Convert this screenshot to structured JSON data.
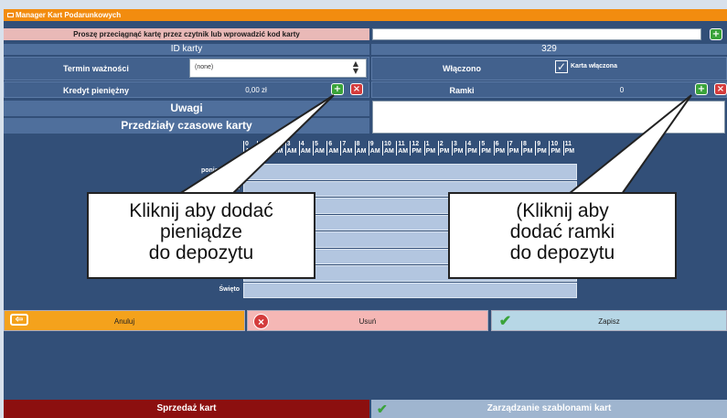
{
  "window": {
    "title": "Manager Kart Podarunkowych"
  },
  "swipe": {
    "prompt": "Proszę przeciągnąć kartę przez czytnik lub wprowadzić kod karty",
    "value": ""
  },
  "card": {
    "id_label": "ID karty",
    "id_value": "329",
    "expiry_label": "Termin ważności",
    "expiry_value": "(none)",
    "enabled_label": "Włączono",
    "enabled_checkbox_label": "Karta włączona",
    "credit_label": "Kredyt pieniężny",
    "credit_value": "0,00 zł",
    "frames_label": "Ramki",
    "frames_value": "0",
    "notes_label": "Uwagi",
    "timeslots_label": "Przedziały czasowe karty"
  },
  "schedule": {
    "hours": [
      "0",
      "1",
      "2",
      "3",
      "4",
      "5",
      "6",
      "7",
      "8",
      "9",
      "10",
      "11",
      "12",
      "1",
      "2",
      "3",
      "4",
      "5",
      "6",
      "7",
      "8",
      "9",
      "10",
      "11"
    ],
    "periods": [
      "AM",
      "AM",
      "AM",
      "AM",
      "AM",
      "AM",
      "AM",
      "AM",
      "AM",
      "AM",
      "AM",
      "AM",
      "PM",
      "PM",
      "PM",
      "PM",
      "PM",
      "PM",
      "PM",
      "PM",
      "PM",
      "PM",
      "PM",
      "PM"
    ],
    "days": [
      "poniedziałek",
      "wtorek",
      "",
      "",
      "",
      "",
      "",
      "Święto"
    ]
  },
  "callouts": {
    "money": [
      "Kliknij aby dodać",
      "pieniądze",
      "do depozytu"
    ],
    "frames": [
      "(Kliknij aby",
      "dodać ramki",
      "do depozytu"
    ]
  },
  "actions": {
    "cancel": "Anuluj",
    "delete": "Usuń",
    "save": "Zapisz"
  },
  "bottom": {
    "sell": "Sprzedaż kart",
    "templates": "Zarządzanie szablonami kart"
  },
  "colors": {
    "orange": "#f28c0f",
    "navy": "#324f78",
    "pink": "#e9b9b7",
    "green": "#3aa33a",
    "red": "#d43b3b",
    "darkred": "#8c0f0f"
  }
}
